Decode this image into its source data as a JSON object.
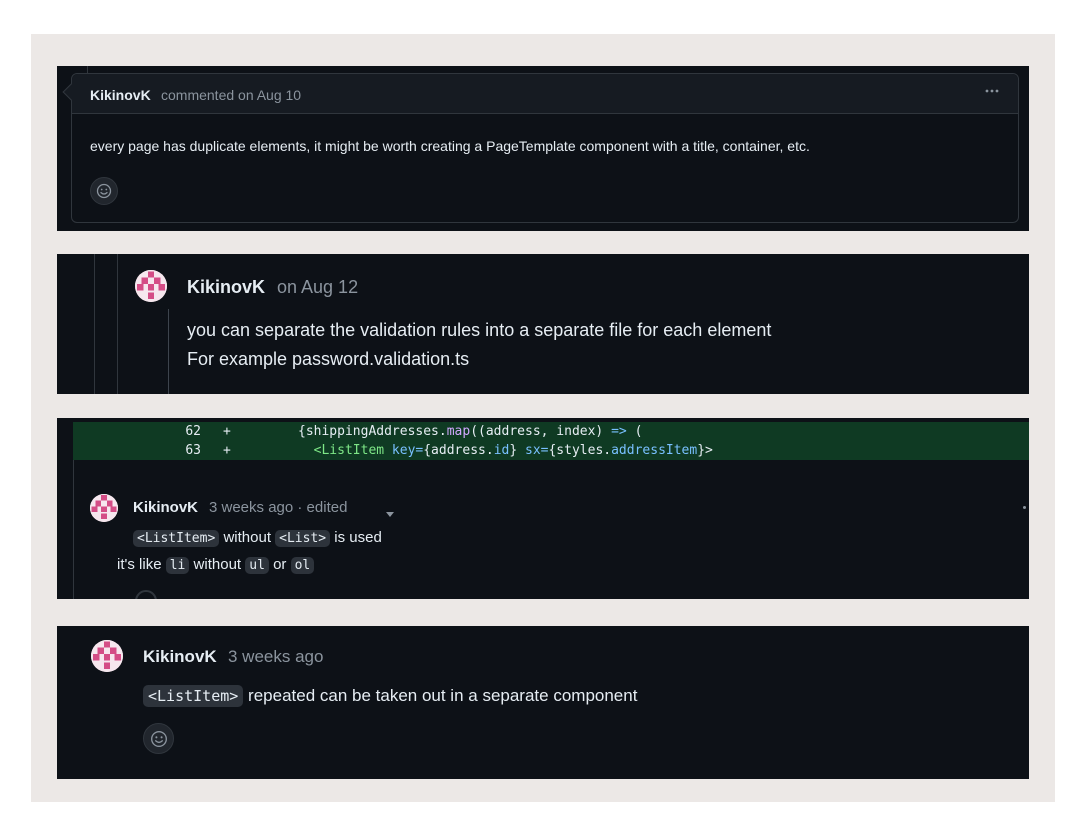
{
  "panel1": {
    "author": "KikinovK",
    "meta": "commented on Aug 10",
    "more_icon": "kebab-horizontal-icon",
    "body": "every page has duplicate elements, it might be worth creating a PageTemplate component with a title, container, etc.",
    "reaction_icon": "smiley-icon"
  },
  "panel2": {
    "author": "KikinovK",
    "meta": "on Aug 12",
    "line1": "you can separate the validation rules into a separate file for each element",
    "line2": "For example password.validation.ts",
    "avatar_icon": "identicon-avatar"
  },
  "panel3": {
    "diff_lines": [
      {
        "num": "62",
        "sign": "+"
      },
      {
        "num": "63",
        "sign": "+"
      }
    ],
    "code_62_a": "{shippingAddresses.",
    "code_62_fn": "map",
    "code_62_b": "((address, index) ",
    "code_62_arrow": "=>",
    "code_62_c": " (",
    "code_63_a": "  <ListItem ",
    "code_63_key": "key=",
    "code_63_b": "{address.",
    "code_63_id": "id",
    "code_63_c": "} ",
    "code_63_sx": "sx=",
    "code_63_d": "{styles.",
    "code_63_item": "addressItem",
    "code_63_e": "}>",
    "author": "KikinovK",
    "meta": "3 weeks ago · edited",
    "dropdown_icon": "triangle-down-icon",
    "chip_listitem": "<ListItem>",
    "text_without": "without",
    "chip_list": "<List>",
    "text_is_used": "is used",
    "text_its_like": "it's like",
    "chip_li": "li",
    "text_without2": "without",
    "chip_ul": "ul",
    "text_or": "or",
    "chip_ol": "ol"
  },
  "panel4": {
    "author": "KikinovK",
    "meta": "3 weeks ago",
    "chip_listitem": "<ListItem>",
    "text": "repeated can be taken out in a separate component",
    "reaction_icon": "smiley-icon"
  },
  "colors": {
    "background": "#0d1117",
    "border": "#30363d",
    "diff_add": "#0f3a23",
    "frame": "#ece8e6",
    "avatar_pink": "#d44d86"
  }
}
